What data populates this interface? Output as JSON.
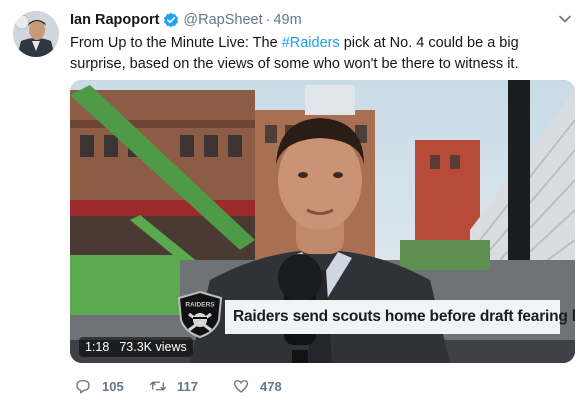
{
  "author": {
    "name": "Ian Rapoport",
    "handle": "@RapSheet",
    "time": "49m",
    "verified": true
  },
  "tweet": {
    "text_before": "From Up to the Minute Live: The ",
    "hashtag": "#Raiders",
    "text_after": " pick at No. 4 could be a big surprise, based on the views of some who won't be there to witness it."
  },
  "video": {
    "lower_third_logo_text": "RAIDERS",
    "lower_third_headline": "Raiders send scouts home before draft fearing leaks",
    "duration": "1:18",
    "views": "73.3K views"
  },
  "actions": {
    "replies": "105",
    "retweets": "117",
    "likes": "478"
  },
  "colors": {
    "link": "#1da1f2",
    "verified": "#1da1f2",
    "muted": "#657786"
  }
}
